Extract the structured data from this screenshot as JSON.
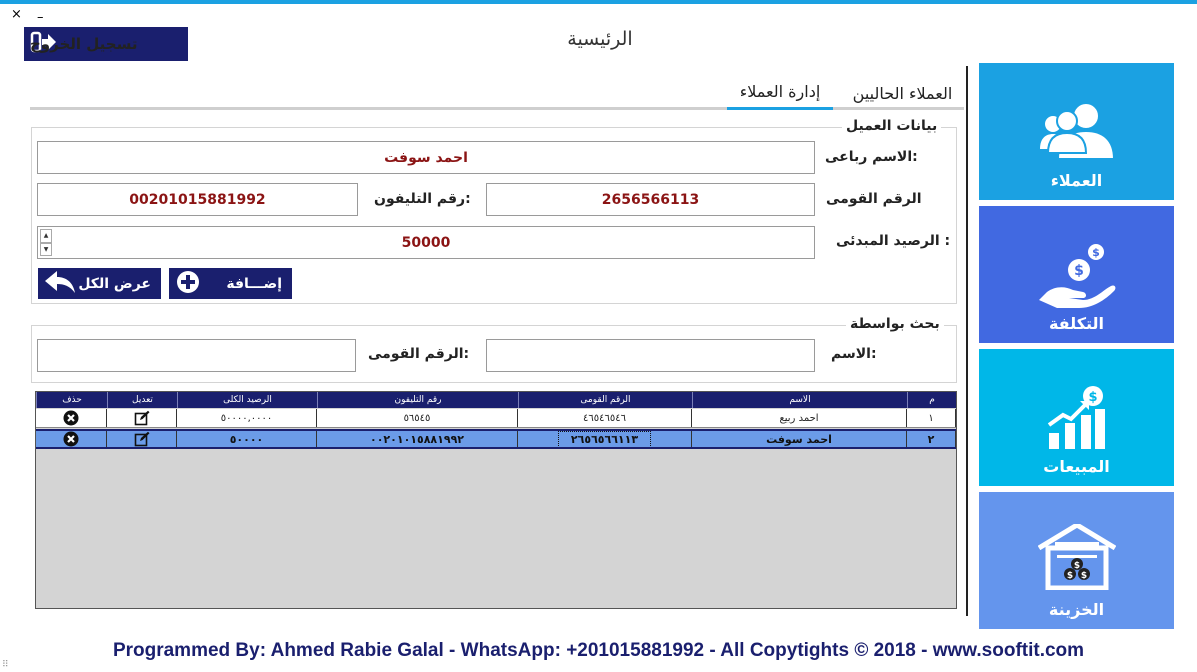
{
  "window": {
    "close_glyph": "×",
    "minimize_glyph": "–"
  },
  "header": {
    "logout_label": "تسجيل الخروج",
    "title": "الرئيسية"
  },
  "tabs": [
    {
      "label": "العملاء الحاليين",
      "active": false
    },
    {
      "label": "إدارة العملاء",
      "active": true
    }
  ],
  "client_form": {
    "group_title": "بيانات العميل",
    "name_label": "الاسم رباعى:",
    "name_value": "احمد سوفت",
    "national_id_label": "الرقم القومى",
    "national_id_value": "2656566113",
    "phone_label": "رقم التليفون:",
    "phone_value": "00201015881992",
    "balance_label": "الرصيد المبدئى :",
    "balance_value": "50000",
    "add_label": "إضـــافة",
    "show_all_label": "عرض الكل"
  },
  "search": {
    "group_title": "بحث بواسطة",
    "name_label": "الاسم:",
    "name_value": "",
    "national_id_label": "الرقم القومى:",
    "national_id_value": ""
  },
  "table": {
    "columns": [
      "م",
      "الاسم",
      "الرقم القومى",
      "رقم التليفون",
      "الرصيد الكلى",
      "تعديل",
      "حذف"
    ],
    "rows": [
      {
        "index": "١",
        "name": "احمد ربيع",
        "national_id": "٤٦٥٤٦٥٤٦",
        "phone": "٥٦٥٤٥",
        "balance": "٥٠٠٠٠,٠٠٠٠"
      },
      {
        "index": "٢",
        "name": "احمد سوفت",
        "national_id": "٢٦٥٦٥٦٦١١٣",
        "phone": "٠٠٢٠١٠١٥٨٨١٩٩٢",
        "balance": "٥٠٠٠٠"
      }
    ],
    "selected_row": 1
  },
  "sidebar": {
    "tiles": [
      {
        "label": "العملاء",
        "color": "#1ba1e2",
        "icon": "users-icon"
      },
      {
        "label": "التكلفة",
        "color": "#4169e1",
        "icon": "money-hand-icon"
      },
      {
        "label": "المبيعات",
        "color": "#00b7e8",
        "icon": "sales-chart-icon"
      },
      {
        "label": "الخزينة",
        "color": "#6495ed",
        "icon": "treasury-icon"
      }
    ]
  },
  "footer": {
    "text": "Programmed By: Ahmed Rabie Galal - WhatsApp: +201015881992 - All Copytights © 2018 - www.sooftit.com"
  },
  "colors": {
    "accent": "#1ba1e2",
    "navy": "#1a1f6e",
    "field_text": "#8b1414",
    "selected_row": "#6b9be8"
  }
}
